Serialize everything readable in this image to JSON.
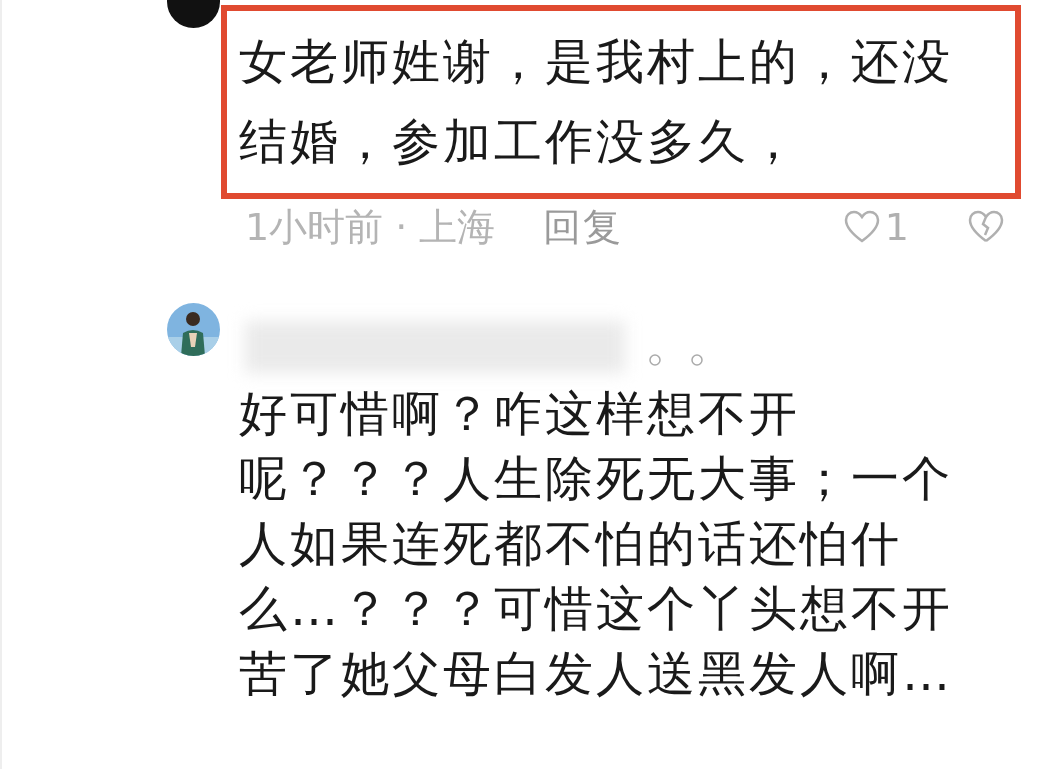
{
  "comments": [
    {
      "avatar": {
        "kind": "dark"
      },
      "highlighted": true,
      "lines": [
        "女老师姓谢，是我村上的，还没",
        "结婚，参加工作没多久，"
      ],
      "time_location": "1小时前 · 上海",
      "reply": "回复",
      "likes": "1"
    },
    {
      "highlighted": false,
      "lines": [
        "好可惜啊？咋这样想不开",
        "呢？？？人生除死无大事；一个",
        "人如果连死都不怕的话还怕什",
        "么…？？？可惜这个丫头想不开",
        "苦了她父母白发人送黑发人啊…"
      ]
    }
  ]
}
